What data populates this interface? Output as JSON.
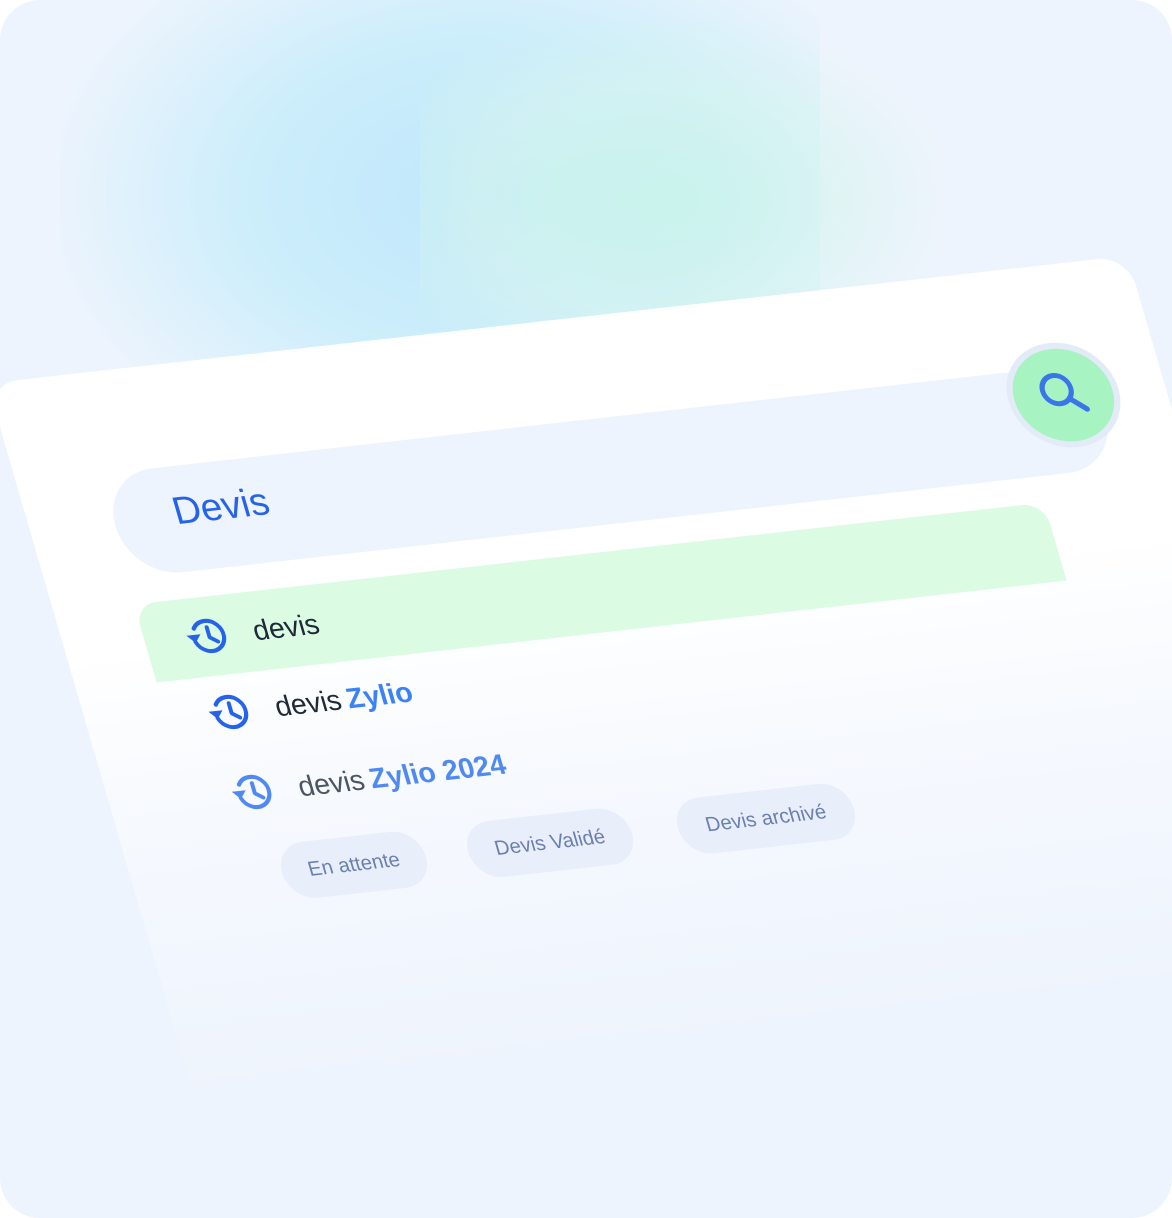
{
  "search": {
    "value": "Devis"
  },
  "suggestions": [
    {
      "plain": "devis",
      "bold": ""
    },
    {
      "plain": "devis",
      "bold": "Zylio"
    },
    {
      "plain": "devis",
      "bold": "Zylio 2024"
    }
  ],
  "chips": [
    "En attente",
    "Devis Validé",
    "Devis archivé"
  ],
  "colors": {
    "accent_blue": "#2563eb",
    "search_button": "#a7f3c2",
    "highlight_row": "#dcfbe3",
    "chip_bg": "#e8effb"
  },
  "icons": {
    "search_button": "search-icon",
    "suggestion": "history-icon"
  }
}
